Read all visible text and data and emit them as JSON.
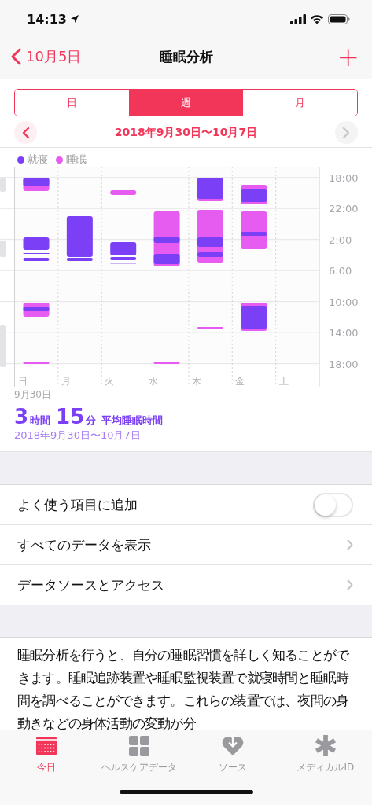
{
  "status_bar": {
    "time": "14:13"
  },
  "nav": {
    "back_label": "10月5日",
    "title": "睡眠分析",
    "add": "+"
  },
  "segments": [
    {
      "label": "日",
      "selected": false
    },
    {
      "label": "週",
      "selected": true
    },
    {
      "label": "月",
      "selected": false
    }
  ],
  "range": {
    "label": "2018年9月30日〜10月7日",
    "next_disabled": true
  },
  "legend": [
    {
      "label": "就寝",
      "color": "#7b3ff5"
    },
    {
      "label": "睡眠",
      "color": "#e65cf0"
    }
  ],
  "chart": {
    "time_ticks": [
      "18:00",
      "22:00",
      "2:00",
      "6:00",
      "10:00",
      "14:00",
      "18:00"
    ],
    "days": [
      "日",
      "月",
      "火",
      "水",
      "木",
      "金",
      "土"
    ],
    "start_date": "9月30日"
  },
  "summary": {
    "hours": "3",
    "hours_unit": "時間",
    "minutes": "15",
    "minutes_unit": "分",
    "caption": "平均睡眠時間",
    "range": "2018年9月30日〜10月7日"
  },
  "settings": [
    {
      "kind": "toggle",
      "label": "よく使う項目に追加",
      "on": false
    },
    {
      "kind": "link",
      "label": "すべてのデータを表示"
    },
    {
      "kind": "link",
      "label": "データソースとアクセス"
    }
  ],
  "description": "睡眠分析を行うと、自分の睡眠習慣を詳しく知ることができます。睡眠追跡装置や睡眠監視装置で就寝時間と睡眠時間を調べることができます。これらの装置では、夜間の身動きなどの身体活動の変動が分",
  "tab_bar": [
    {
      "kind": "today",
      "label": "今日",
      "selected": true
    },
    {
      "kind": "data",
      "label": "ヘルスケアデータ",
      "selected": false
    },
    {
      "kind": "sources",
      "label": "ソース",
      "selected": false
    },
    {
      "kind": "medical",
      "label": "メディカルID",
      "selected": false
    }
  ]
}
